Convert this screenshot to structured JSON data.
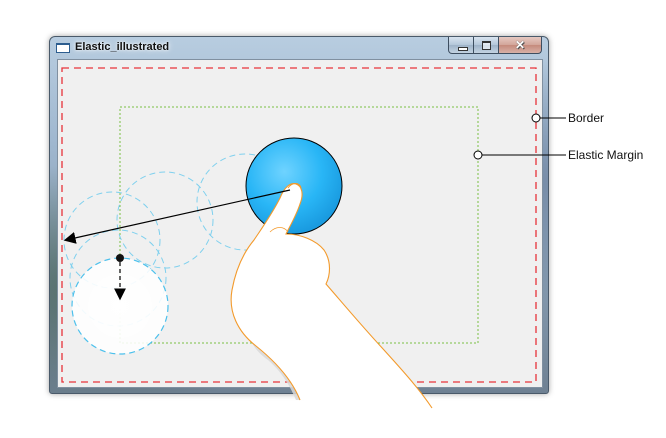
{
  "window": {
    "title": "Elastic_illustrated",
    "buttons": {
      "minimize": "minimize",
      "maximize": "maximize",
      "close": "✕"
    }
  },
  "callouts": {
    "border": "Border",
    "elastic_margin": "Elastic Margin"
  },
  "colors": {
    "border_line": "#e8333a",
    "elastic_margin_line": "#7ac143",
    "circle_fill": "#29b6f6",
    "ghost_circle": "#7fd0ee",
    "hand_outline": "#f39a2b"
  },
  "icons": [
    "window-icon",
    "minimize-icon",
    "maximize-icon",
    "close-icon",
    "hand-icon"
  ]
}
